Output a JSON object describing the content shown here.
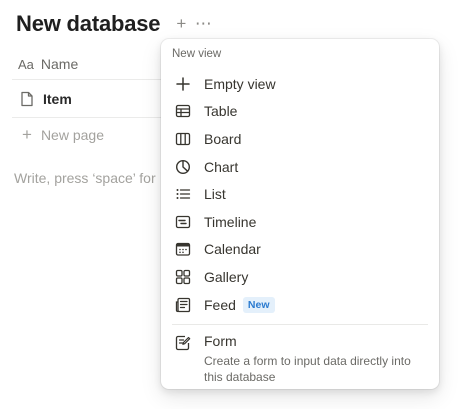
{
  "database": {
    "title": "New database"
  },
  "table": {
    "name_header": "Name",
    "name_header_icon": "text-property-icon",
    "rows": [
      {
        "title": "Item"
      }
    ],
    "new_page_label": "New page",
    "hint_text": "Write, press ‘space’ for"
  },
  "menu": {
    "heading": "New view",
    "items": [
      {
        "label": "Empty view",
        "icon": "plus-icon"
      },
      {
        "label": "Table",
        "icon": "table-icon"
      },
      {
        "label": "Board",
        "icon": "board-icon"
      },
      {
        "label": "Chart",
        "icon": "chart-icon"
      },
      {
        "label": "List",
        "icon": "list-icon"
      },
      {
        "label": "Timeline",
        "icon": "timeline-icon"
      },
      {
        "label": "Calendar",
        "icon": "calendar-icon"
      },
      {
        "label": "Gallery",
        "icon": "gallery-icon"
      },
      {
        "label": "Feed",
        "icon": "feed-icon",
        "badge": "New"
      }
    ],
    "form": {
      "label": "Form",
      "icon": "form-icon",
      "description": "Create a form to input data directly into this database"
    }
  },
  "colors": {
    "badge_text": "#2b7bd0",
    "badge_bg": "#e4f0fb",
    "text": "#37352f",
    "muted": "#6b6a66"
  }
}
